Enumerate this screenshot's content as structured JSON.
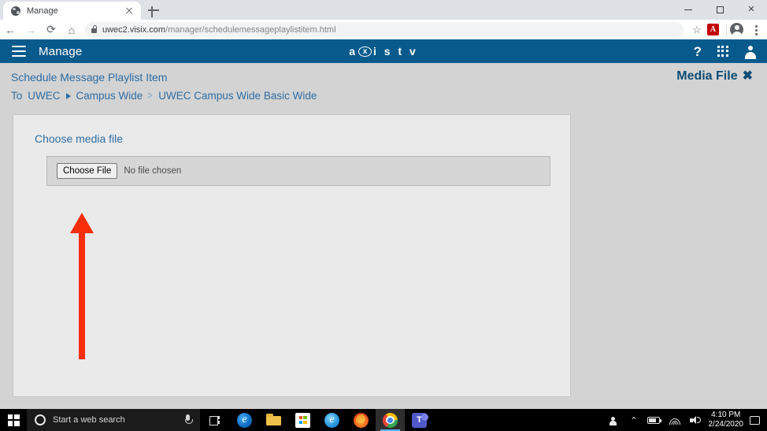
{
  "browser": {
    "tab": {
      "title": "Manage",
      "favicon": "globe-icon",
      "close": "✕"
    },
    "new_tab_label": "+",
    "window_controls": {
      "minimize": "−",
      "maximize": "□",
      "close": "✕"
    },
    "nav": {
      "back": "←",
      "forward": "→",
      "reload": "⟳",
      "home": "⌂"
    },
    "address": {
      "lock_icon": "lock-icon",
      "url_host": "uwec2.visix.com",
      "url_path": "/manager/schedulemessageplaylistitem.html",
      "full_url": "uwec2.visix.com/manager/schedulemessageplaylistitem.html"
    },
    "bookmark_star": "☆",
    "extension_pdf_label": "A",
    "profile_icon": "profile-icon",
    "menu_icon": "kebab-menu-icon"
  },
  "app": {
    "menu_icon": "hamburger-menu-icon",
    "title": "Manage",
    "brand": {
      "part1": "a",
      "circle_letter": "x",
      "part2": "i s t v"
    },
    "help_icon": "?",
    "apps_icon": "app-grid-icon",
    "account_icon": "account-icon"
  },
  "page": {
    "title": "Schedule Message Playlist Item",
    "breadcrumb": {
      "prefix": "To",
      "items": [
        "UWEC",
        "Campus Wide",
        "UWEC Campus Wide Basic Wide"
      ]
    },
    "media_file_tag": {
      "label": "Media File",
      "close": "✖"
    }
  },
  "panel": {
    "label": "Choose media file",
    "file_input": {
      "button_label": "Choose File",
      "status_text": "No file chosen"
    }
  },
  "annotation": {
    "type": "arrow",
    "direction": "up",
    "color": "#f92e0a",
    "points_to": "Choose File"
  },
  "taskbar": {
    "start_icon": "windows-start-icon",
    "search_placeholder": "Start a web search",
    "cortana_icon": "cortana-circle-icon",
    "mic_icon": "microphone-icon",
    "task_view_icon": "task-view-icon",
    "apps": [
      {
        "name": "microsoft-edge",
        "label": "e",
        "active": false
      },
      {
        "name": "file-explorer",
        "label": "",
        "active": false
      },
      {
        "name": "microsoft-store",
        "label": "",
        "active": false
      },
      {
        "name": "internet-explorer",
        "label": "e",
        "active": false
      },
      {
        "name": "mozilla-firefox",
        "label": "",
        "active": false
      },
      {
        "name": "google-chrome",
        "label": "",
        "active": true
      },
      {
        "name": "microsoft-teams",
        "label": "T",
        "active": false
      }
    ],
    "tray": {
      "people_share_icon": "people-share-icon",
      "overflow_chevron": "⌃",
      "battery_icon": "battery-icon",
      "wifi_icon": "wifi-icon",
      "volume_icon": "volume-icon",
      "time": "4:10 PM",
      "date": "2/24/2020",
      "notifications_icon": "notification-icon"
    }
  },
  "colors": {
    "app_bar_blue": "#065a8c",
    "page_bg": "#d3d3d3",
    "panel_bg": "#eaeaea",
    "link_blue": "#2e6da4",
    "annotation_red": "#f92e0a"
  }
}
